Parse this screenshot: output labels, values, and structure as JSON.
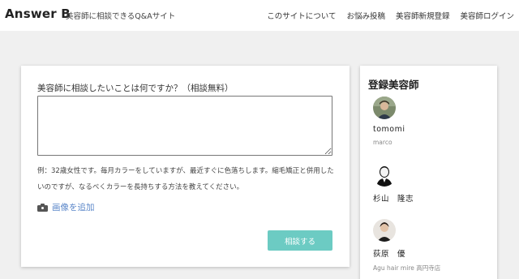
{
  "header": {
    "logo": "Answer B",
    "tagline": "美容師に相談できるQ&Aサイト",
    "nav": [
      {
        "label": "このサイトについて"
      },
      {
        "label": "お悩み投稿"
      },
      {
        "label": "美容師新規登録"
      },
      {
        "label": "美容師ログイン"
      }
    ]
  },
  "form": {
    "question_label": "美容師に相談したいことは何ですか？（相談無料）",
    "textarea_value": "",
    "example_text": "例：32歳女性です。毎月カラーをしていますが、最近すぐに色落ちします。縮毛矯正と併用したいのですが、なるべくカラーを長持ちする方法を教えてください。",
    "add_image_label": "画像を追加",
    "add_image_icon": "camera-icon",
    "submit_label": "相談する",
    "submit_color": "#6ccbc3",
    "link_color": "#5b87c9"
  },
  "sidebar": {
    "title": "登録美容師",
    "stylists": [
      {
        "name": "tomomi",
        "sub": "marco",
        "avatar": "photo-avatar"
      },
      {
        "name": "杉山　隆志",
        "sub": "",
        "avatar": "person-silhouette-avatar"
      },
      {
        "name": "荻原　優",
        "sub": "Agu hair mire 高円寺店",
        "avatar": "photo-avatar"
      }
    ]
  }
}
